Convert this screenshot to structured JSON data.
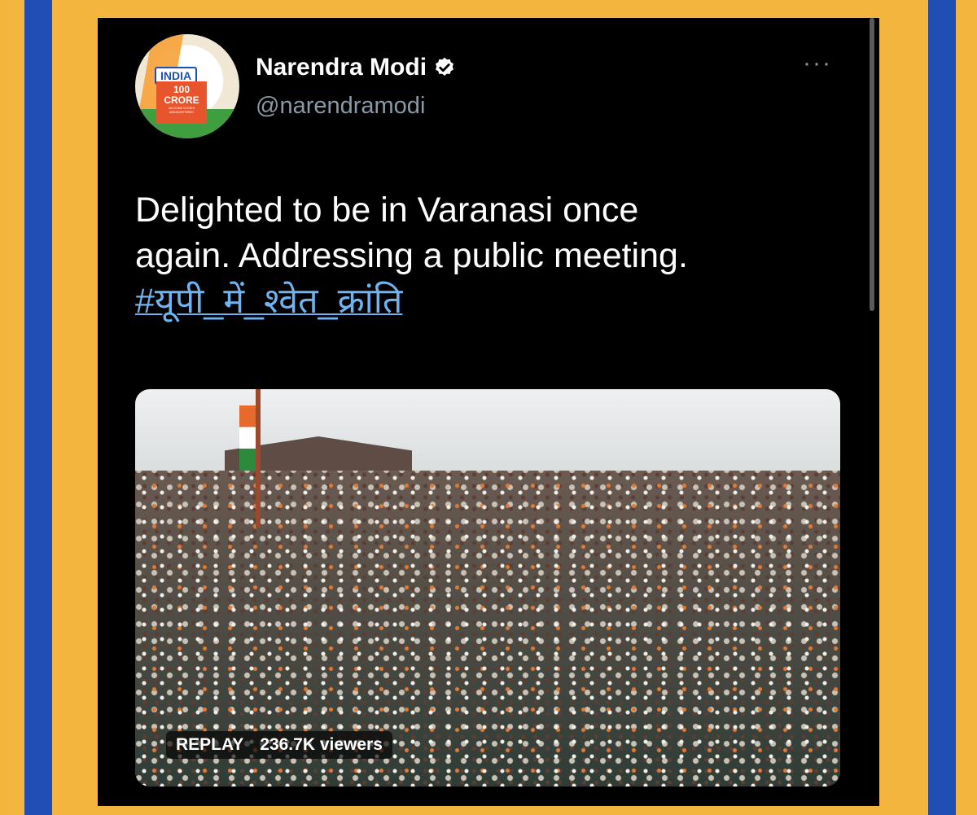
{
  "tweet": {
    "display_name": "Narendra Modi",
    "handle": "@narendramodi",
    "verified": true,
    "more_icon": "···",
    "text_line1": "Delighted to be in Varanasi once",
    "text_line2": "again. Addressing a public meeting.",
    "hashtag": "#यूपी_में_श्वेत_क्रांति",
    "avatar": {
      "badge_top": "INDIA",
      "badge_count": "100",
      "badge_unit": "CRORE",
      "badge_caption_1": "VACCINE DOSES",
      "badge_caption_2": "ADMINISTERED"
    }
  },
  "video": {
    "status_label": "REPLAY",
    "viewers": "236.7K viewers"
  },
  "colors": {
    "background": "#f4b53f",
    "border_blue": "#1f4fb3",
    "card": "#000000",
    "link": "#6fb3f0",
    "handle_gray": "#8b98a5"
  }
}
